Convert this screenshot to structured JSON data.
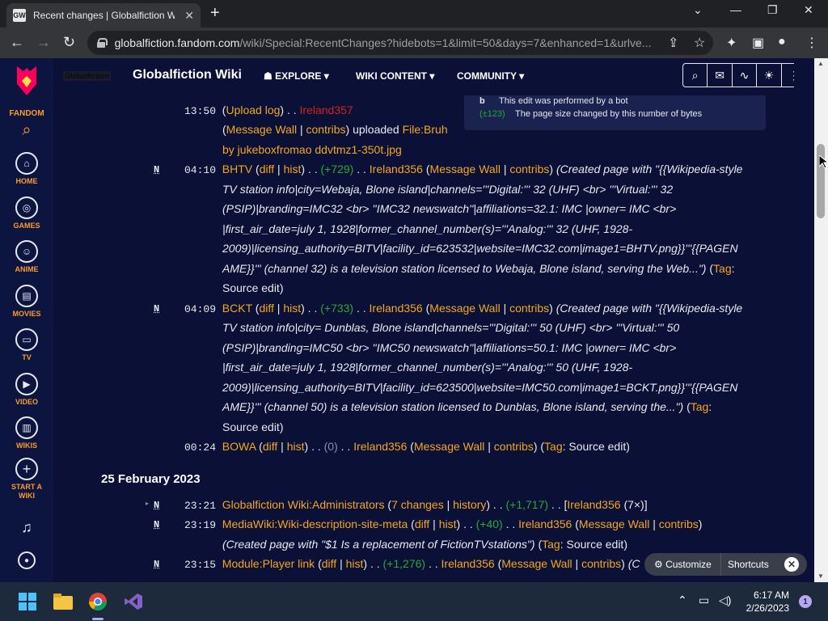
{
  "browser": {
    "tab_title": "Recent changes | Globalfiction Wiki",
    "favicon_text": "GW",
    "url_host": "globalfiction.fandom.com",
    "url_path": "/wiki/Special:RecentChanges?hidebots=1&limit=50&days=7&enhanced=1&urlve..."
  },
  "rail": {
    "brand": "FANDOM",
    "items": [
      {
        "label": "HOME",
        "icon": "home-icon"
      },
      {
        "label": "GAMES",
        "icon": "gamepad-icon"
      },
      {
        "label": "ANIME",
        "icon": "anime-icon"
      },
      {
        "label": "MOVIES",
        "icon": "film-icon"
      },
      {
        "label": "TV",
        "icon": "tv-icon"
      },
      {
        "label": "VIDEO",
        "icon": "play-icon"
      },
      {
        "label": "WIKIS",
        "icon": "book-icon"
      },
      {
        "label": "START A WIKI",
        "icon": "plus-icon"
      }
    ]
  },
  "wiki": {
    "wordmark": "Globalfiction",
    "name": "Globalfiction Wiki",
    "nav": [
      "EXPLORE",
      "WIKI CONTENT",
      "COMMUNITY"
    ]
  },
  "legend": {
    "bot_flag": "b",
    "bot_text": "This edit was performed by a bot",
    "size_sample": "(±123)",
    "size_text": "The page size changed by this number of bytes"
  },
  "rc": {
    "e1": {
      "time": "13:50",
      "upload_log": "Upload log",
      "user": "Ireland357",
      "wall": "Message Wall",
      "contribs": "contribs",
      "action": "uploaded",
      "file": "File:Bruh",
      "file2": "by jukeboxfromao ddvtmz1-350t.jpg"
    },
    "e2": {
      "flag": "N",
      "time": "04:10",
      "page": "BHTV",
      "diff": "diff",
      "hist": "hist",
      "size": "(+729)",
      "user": "Ireland356",
      "wall": "Message Wall",
      "contribs": "contribs",
      "summary": [
        "(Created page with \"{{Wikipedia-style",
        "TV station info|city=Webaja, Blone island|channels='''Digital:''' 32 (UHF) <br> '''Virtual:''' 32",
        "(PSIP)|branding=IMC32 <br> ''IMC32 newswatch''|affiliations=32.1: IMC |owner= IMC <br>",
        "|first_air_date=july 1, 1928|former_channel_number(s)='''Analog:''' 32 (UHF, 1928-",
        "2009)|licensing_authority=BITV|facility_id=623532|website=IMC32.com|image1=BHTV.png}}'''{{PAGEN",
        "AME}}''' (channel 32) is a television station licensed to Webaja, Blone island, serving the Web...\")"
      ],
      "tag": "Tag",
      "tag_value": "Source edit)"
    },
    "e3": {
      "flag": "N",
      "time": "04:09",
      "page": "BCKT",
      "diff": "diff",
      "hist": "hist",
      "size": "(+733)",
      "user": "Ireland356",
      "wall": "Message Wall",
      "contribs": "contribs",
      "summary": [
        "(Created page with \"{{Wikipedia-style",
        "TV station info|city= Dunblas, Blone island|channels='''Digital:''' 50 (UHF) <br> '''Virtual:''' 50",
        "(PSIP)|branding=IMC50 <br> ''IMC50 newswatch''|affiliations=50.1: IMC |owner= IMC <br>",
        "|first_air_date=july 1, 1928|former_channel_number(s)='''Analog:''' 50 (UHF, 1928-",
        "2009)|licensing_authority=BITV|facility_id=623500|website=IMC50.com|image1=BCKT.png}}'''{{PAGEN",
        "AME}}''' (channel 50) is a television station licensed to Dunblas, Blone island, serving the...\")"
      ],
      "tag": "Tag",
      "tag_value": "Source edit)"
    },
    "e4": {
      "time": "00:24",
      "page": "BOWA",
      "diff": "diff",
      "hist": "hist",
      "size": "(0)",
      "user": "Ireland356",
      "wall": "Message Wall",
      "contribs": "contribs",
      "tag": "Tag",
      "tag_value": ": Source edit)"
    },
    "day2": "25 February 2023",
    "e5": {
      "flag": "N",
      "time": "23:21",
      "page": "Globalfiction Wiki:Administrators",
      "changes": "7 changes",
      "history": "history",
      "size": "(+1,717)",
      "user": "Ireland356",
      "count": "(7×)]"
    },
    "e6": {
      "flag": "N",
      "time": "23:19",
      "page": "MediaWiki:Wiki-description-site-meta",
      "diff": "diff",
      "hist": "hist",
      "size": "(+40)",
      "user": "Ireland356",
      "wall": "Message Wall",
      "contribs": "contribs",
      "summary": "(Created page with \"$1 Is a replacement of FictionTVstations\")",
      "tag": "Tag",
      "tag_value": ": Source edit)"
    },
    "e7": {
      "flag": "N",
      "time": "23:15",
      "page": "Module:Player link",
      "diff": "diff",
      "hist": "hist",
      "size": "(+1,276)",
      "user": "Ireland356",
      "wall": "Message Wall",
      "contribs": "contribs",
      "trunc": "(C"
    }
  },
  "floatbar": {
    "customize": "Customize",
    "shortcuts": "Shortcuts"
  },
  "taskbar": {
    "time": "6:17 AM",
    "date": "2/26/2023",
    "badge": "1"
  },
  "colors": {
    "link": "#f4a620",
    "positive": "#2aa63a",
    "redlink": "#d32020",
    "page_bg": "#0b1136",
    "accent": "#fa9a2c"
  }
}
